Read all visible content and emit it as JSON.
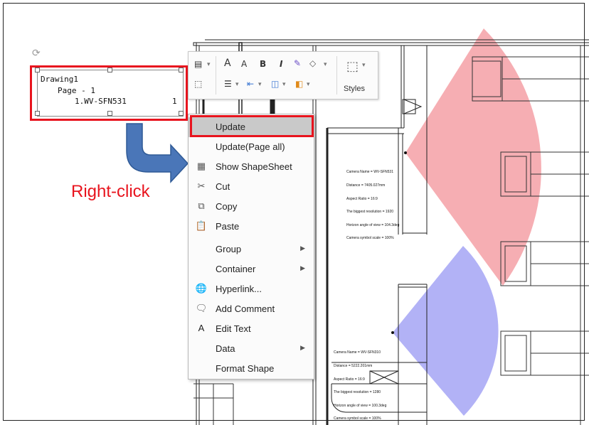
{
  "drawing_shape": {
    "lines": [
      "Drawing1",
      "Page - 1",
      "1.WV-SFN531",
      "1"
    ]
  },
  "toolbar": {
    "increase_font": "A",
    "decrease_font": "A",
    "bold": "B",
    "italic": "I",
    "styles_label": "Styles"
  },
  "context_menu": {
    "items": [
      {
        "label": "Update",
        "icon": "",
        "highlighted": true
      },
      {
        "label": "Update(Page all)",
        "icon": ""
      },
      {
        "label": "Show ShapeSheet",
        "icon": "shapesheet-icon"
      },
      {
        "label": "Cut",
        "icon": "scissors-icon"
      },
      {
        "label": "Copy",
        "icon": "copy-icon"
      },
      {
        "label": "Paste",
        "icon": "paste-icon"
      },
      {
        "label": "Group",
        "icon": "",
        "submenu": true
      },
      {
        "label": "Container",
        "icon": "",
        "submenu": true
      },
      {
        "label": "Hyperlink...",
        "icon": "hyperlink-icon"
      },
      {
        "label": "Add Comment",
        "icon": "comment-icon"
      },
      {
        "label": "Edit Text",
        "icon": "text-icon"
      },
      {
        "label": "Data",
        "icon": "",
        "submenu": true
      },
      {
        "label": "Format Shape",
        "icon": ""
      }
    ]
  },
  "annotation": {
    "right_click_label": "Right-click"
  },
  "cameras": [
    {
      "lines": [
        "Camera Name = WV-SFN531",
        "Distance = 7405.027mm",
        "Aspect Ratio = 16:9",
        "The biggest resolution = 1920",
        "Horizon angle of view = 104.3deg",
        "Camera symbol scale = 100%"
      ]
    },
    {
      "lines": [
        "Camera Name = WV-SFN310",
        "Distance = 5222.201mm",
        "Aspect Ratio = 16:9",
        "The biggest resolution = 1280",
        "Horizon angle of view = 100.3deg",
        "Camera symbol scale = 100%"
      ]
    }
  ],
  "colors": {
    "highlight_red": "#e8141e",
    "camera1_fov": "#f5a0a6",
    "camera2_fov": "#a4a4f5",
    "arrow_blue": "#4a76b8"
  }
}
